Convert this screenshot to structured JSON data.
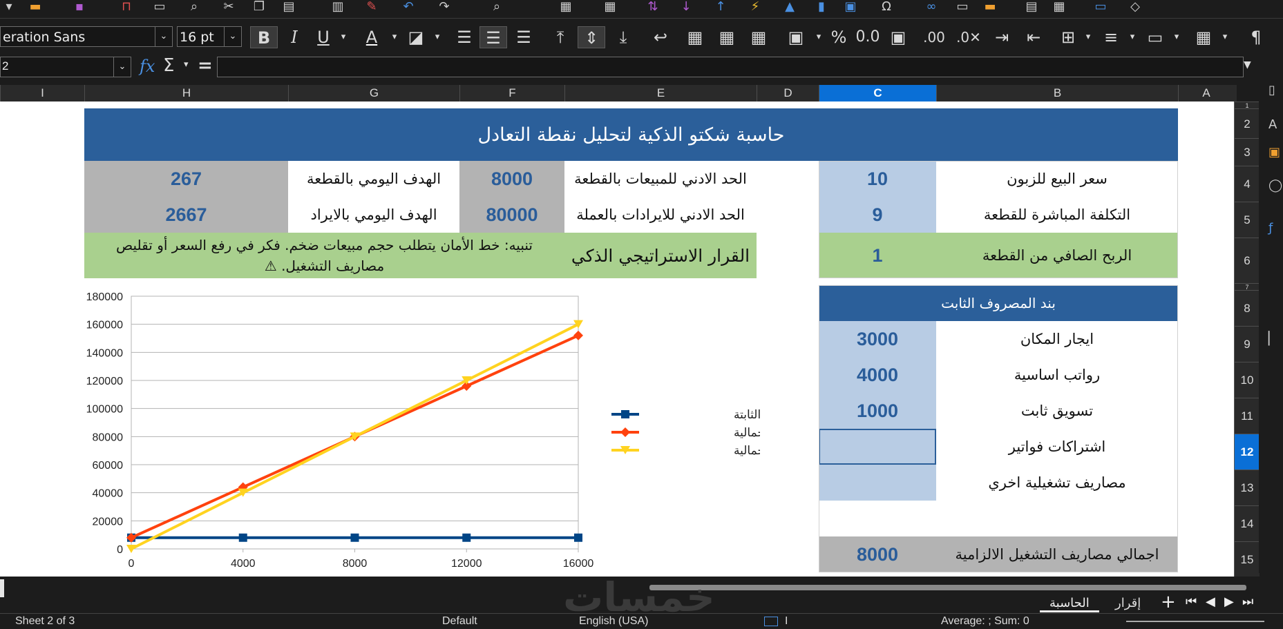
{
  "toolbar": {
    "font_name": "eration Sans",
    "font_size": "16 pt",
    "bold": "B",
    "italic": "I",
    "underline": "U",
    "percent": "%",
    "decimal": "0.0"
  },
  "formula_bar": {
    "name_box": "2",
    "fx": "fx",
    "sigma": "Σ",
    "equals": "=",
    "content": ""
  },
  "columns": [
    {
      "name": "I",
      "sel": false
    },
    {
      "name": "H",
      "sel": false
    },
    {
      "name": "G",
      "sel": false
    },
    {
      "name": "F",
      "sel": false
    },
    {
      "name": "E",
      "sel": false
    },
    {
      "name": "D",
      "sel": false
    },
    {
      "name": "C",
      "sel": true
    },
    {
      "name": "B",
      "sel": false
    },
    {
      "name": "A",
      "sel": false
    }
  ],
  "rows": [
    "1",
    "2",
    "3",
    "4",
    "5",
    "6",
    "7",
    "8",
    "9",
    "10",
    "11",
    "12",
    "13",
    "14",
    "15"
  ],
  "selected_row": "12",
  "title": "حاسبة شكتو الذكية لتحليل نقطة التعادل",
  "inputs": {
    "price_label": "سعر البيع للزبون",
    "price_value": "10",
    "direct_cost_label": "التكلفة المباشرة للقطعة",
    "direct_cost_value": "9",
    "net_profit_label": "الربح الصافي من القطعة",
    "net_profit_value": "1"
  },
  "results": {
    "min_units_label": "الحد الادني للمبيعات بالقطعة",
    "min_units_value": "8000",
    "min_revenue_label": "الحد الادني للايرادات بالعملة",
    "min_revenue_value": "80000",
    "daily_units_label": "الهدف اليومي بالقطعة",
    "daily_units_value": "267",
    "daily_revenue_label": "الهدف اليومي بالايراد",
    "daily_revenue_value": "2667",
    "decision_label": "القرار الاستراتيجي الذكي",
    "decision_text": "تنبيه: خط الأمان يتطلب حجم مبيعات ضخم. فكر في رفع السعر أو تقليص مصاريف التشغيل. ⚠"
  },
  "fixed_costs": {
    "header": "بند المصروف الثابت",
    "items": [
      {
        "label": "ايجار المكان",
        "value": "3000"
      },
      {
        "label": "رواتب اساسية",
        "value": "4000"
      },
      {
        "label": "تسويق ثابت",
        "value": "1000"
      },
      {
        "label": "اشتراكات فواتير",
        "value": ""
      },
      {
        "label": "مصاريف تشغيلية اخري",
        "value": ""
      }
    ],
    "total_label": "اجمالي مصاريف التشغيل الالزامية",
    "total_value": "8000"
  },
  "chart_data": {
    "type": "line",
    "x": [
      0,
      4000,
      8000,
      12000,
      16000
    ],
    "ylim": [
      0,
      180000
    ],
    "yticks": [
      0,
      20000,
      40000,
      60000,
      80000,
      100000,
      120000,
      140000,
      160000,
      180000
    ],
    "series": [
      {
        "name": "التكاليف الثابتة",
        "color": "#004586",
        "marker": "square",
        "values": [
          8000,
          8000,
          8000,
          8000,
          8000
        ]
      },
      {
        "name": "التكلفة الاجمالية",
        "color": "#ff420e",
        "marker": "diamond",
        "values": [
          8000,
          44000,
          80000,
          116000,
          152000
        ]
      },
      {
        "name": "الايرادات الاجمالية",
        "color": "#ffd320",
        "marker": "triangle",
        "values": [
          0,
          40000,
          80000,
          120000,
          160000
        ]
      }
    ],
    "grid": true,
    "legend": "right"
  },
  "sheet_tabs": {
    "active": "الحاسبة",
    "other": "إقرار"
  },
  "status": {
    "sheet": "Sheet 2 of 3",
    "style": "Default",
    "language": "English (USA)",
    "summary": "Average: ; Sum: 0"
  },
  "colors": {
    "title_bg": "#2b5f9a",
    "value_blue_bg": "#b8cce4",
    "gray_bg": "#b3b3b3",
    "green_bg": "#a9d08e",
    "number_text": "#2a5d9a",
    "selection": "#0a6fd6"
  }
}
